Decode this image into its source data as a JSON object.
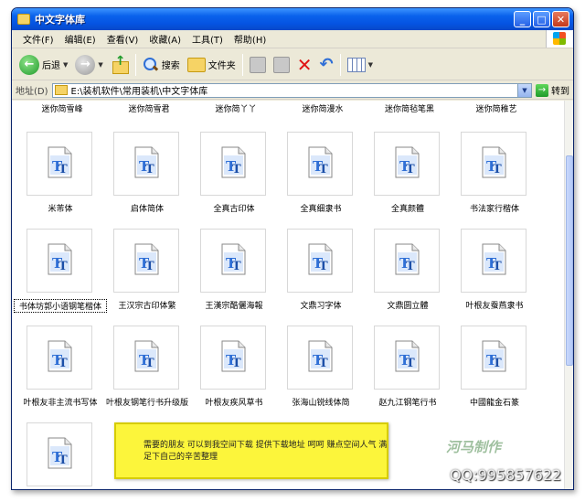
{
  "window": {
    "title": "中文字体库"
  },
  "menubar": {
    "items": [
      "文件(F)",
      "编辑(E)",
      "查看(V)",
      "收藏(A)",
      "工具(T)",
      "帮助(H)"
    ]
  },
  "toolbar": {
    "back_label": "后退",
    "search_label": "搜索",
    "folders_label": "文件夹"
  },
  "address": {
    "label": "地址(D)",
    "path": "E:\\装机软件\\常用装机\\中文字体库",
    "go_label": "转到"
  },
  "files": {
    "top_row": [
      "迷你简雪峰",
      "迷你简雪君",
      "迷你简丫丫",
      "迷你简漫水",
      "迷你简毡笔黑",
      "迷你简稚艺"
    ],
    "items": [
      {
        "name": "米芾体"
      },
      {
        "name": "启体简体"
      },
      {
        "name": "全真古印体"
      },
      {
        "name": "全真细隶书"
      },
      {
        "name": "全真颜體"
      },
      {
        "name": "书法家行楷体"
      },
      {
        "name": "书体坊郭小语钢笔楷体",
        "selected": true
      },
      {
        "name": "王汉宗古印体繁"
      },
      {
        "name": "王漢宗酷儷海報"
      },
      {
        "name": "文鼎习字体"
      },
      {
        "name": "文鼎圆立體"
      },
      {
        "name": "叶根友蚕燕隶书"
      },
      {
        "name": "叶根友非主流书写体"
      },
      {
        "name": "叶根友钢笔行书升级版"
      },
      {
        "name": "叶根友疾风草书"
      },
      {
        "name": "张海山锐线体简"
      },
      {
        "name": "赵九江钢笔行书"
      },
      {
        "name": "中國龍金石篆"
      },
      {
        "name": ""
      }
    ]
  },
  "note": {
    "text": "需要的朋友 可以到我空间下载  提供下载地址 呵呵 赚点空间人气 满足下自己的辛苦整理"
  },
  "watermark": {
    "brand": "河马制作",
    "qq": "QQ:995857622"
  },
  "colors": {
    "titlebar": "#0554e2",
    "note_bg": "#fcf53b",
    "icon_blue": "#2f6fd6"
  }
}
